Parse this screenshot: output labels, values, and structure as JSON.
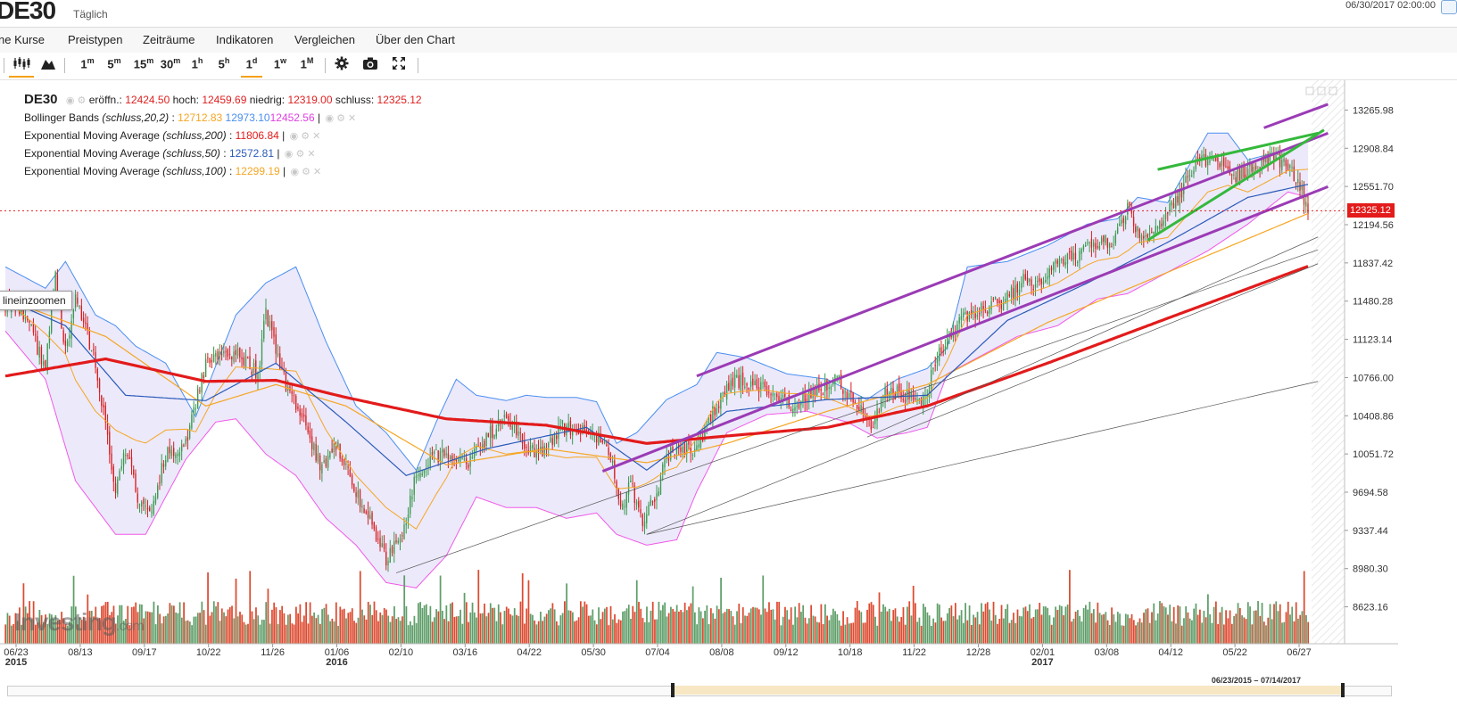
{
  "header": {
    "symbol": "DE30",
    "interval": "Täglich",
    "datetime": "06/30/2017 02:00:00"
  },
  "menu": [
    "ne Kurse",
    "Preistypen",
    "Zeiträume",
    "Indikatoren",
    "Vergleichen",
    "Über den Chart"
  ],
  "toolbar": {
    "timeframes": [
      "1m",
      "5m",
      "15m",
      "30m",
      "1h",
      "5h",
      "1d",
      "1w",
      "1M"
    ],
    "active": "1d"
  },
  "legend": {
    "symbol": "DE30",
    "open_label": "eröffn.:",
    "open": "12424.50",
    "high_label": "hoch:",
    "high": "12459.69",
    "low_label": "niedrig:",
    "low": "12319.00",
    "close_label": "schluss:",
    "close": "12325.12",
    "bb_label": "Bollinger Bands",
    "bb_params": "(schluss,20,2)",
    "bb_mid": "12712.83",
    "bb_upper": "12973.10",
    "bb_lower": "12452.56",
    "ema200_label": "Exponential Moving Average",
    "ema200_params": "(schluss,200)",
    "ema200_value": "11806.84",
    "ema50_label": "Exponential Moving Average",
    "ema50_params": "(schluss,50)",
    "ema50_value": "12572.81",
    "ema100_label": "Exponential Moving Average",
    "ema100_params": "(schluss,100)",
    "ema100_value": "12299.19"
  },
  "zoom_tooltip": "lineinzoomen",
  "last_price_label": "12325.12",
  "watermark": {
    "main": "Investing",
    "suffix": ".com"
  },
  "navigator": {
    "range": "06/23/2015 – 07/14/2017"
  },
  "colors": {
    "up": "#3a9a4e",
    "down": "#d61f1f",
    "bb_upper": "#4a8ff0",
    "bb_lower": "#f05ae8",
    "bb_mid": "#f5a623",
    "bb_fill": "#e4e0f9",
    "ema200": "#e21b1b",
    "ema50": "#2a5bb8",
    "ema100": "#f5a623",
    "channel": "#9b3bb5",
    "wedge": "#35b83c",
    "vol_up": "#5f9e69",
    "vol_down": "#dd4a30"
  },
  "chart_data": {
    "type": "candlestick",
    "y_ticks": [
      "13265.98",
      "12908.84",
      "12551.70",
      "12194.56",
      "11837.42",
      "11480.28",
      "11123.14",
      "10766.00",
      "10408.86",
      "10051.72",
      "9694.58",
      "9337.44",
      "8980.30",
      "8623.16"
    ],
    "y_range": [
      8444.59,
      13444.55
    ],
    "x_ticks": [
      {
        "label": "06/23",
        "sub": "2015"
      },
      {
        "label": "08/13",
        "sub": ""
      },
      {
        "label": "09/17",
        "sub": ""
      },
      {
        "label": "10/22",
        "sub": ""
      },
      {
        "label": "11/26",
        "sub": ""
      },
      {
        "label": "01/06",
        "sub": "2016"
      },
      {
        "label": "02/10",
        "sub": ""
      },
      {
        "label": "03/16",
        "sub": ""
      },
      {
        "label": "04/22",
        "sub": ""
      },
      {
        "label": "05/30",
        "sub": ""
      },
      {
        "label": "07/04",
        "sub": ""
      },
      {
        "label": "08/08",
        "sub": ""
      },
      {
        "label": "09/12",
        "sub": ""
      },
      {
        "label": "10/18",
        "sub": ""
      },
      {
        "label": "11/22",
        "sub": ""
      },
      {
        "label": "12/28",
        "sub": ""
      },
      {
        "label": "02/01",
        "sub": "2017"
      },
      {
        "label": "03/08",
        "sub": ""
      },
      {
        "label": "04/12",
        "sub": ""
      },
      {
        "label": "05/22",
        "sub": ""
      },
      {
        "label": "06/27",
        "sub": ""
      }
    ],
    "close_anchors": [
      [
        0,
        11480
      ],
      [
        10,
        11350
      ],
      [
        20,
        10850
      ],
      [
        25,
        11700
      ],
      [
        30,
        11000
      ],
      [
        35,
        11500
      ],
      [
        45,
        10900
      ],
      [
        55,
        9700
      ],
      [
        60,
        10100
      ],
      [
        66,
        9650
      ],
      [
        72,
        9450
      ],
      [
        80,
        10050
      ],
      [
        90,
        10150
      ],
      [
        100,
        10900
      ],
      [
        115,
        11000
      ],
      [
        126,
        10800
      ],
      [
        130,
        11380
      ],
      [
        140,
        10700
      ],
      [
        148,
        10400
      ],
      [
        158,
        9900
      ],
      [
        165,
        10150
      ],
      [
        175,
        9700
      ],
      [
        183,
        9400
      ],
      [
        190,
        9050
      ],
      [
        198,
        9300
      ],
      [
        205,
        9850
      ],
      [
        215,
        10050
      ],
      [
        230,
        9950
      ],
      [
        242,
        10250
      ],
      [
        250,
        10400
      ],
      [
        260,
        10100
      ],
      [
        268,
        10050
      ],
      [
        278,
        10300
      ],
      [
        290,
        10250
      ],
      [
        300,
        10150
      ],
      [
        308,
        9550
      ],
      [
        312,
        9780
      ],
      [
        318,
        9400
      ],
      [
        325,
        9700
      ],
      [
        330,
        10050
      ],
      [
        345,
        10100
      ],
      [
        352,
        10400
      ],
      [
        362,
        10750
      ],
      [
        372,
        10700
      ],
      [
        382,
        10650
      ],
      [
        392,
        10500
      ],
      [
        405,
        10650
      ],
      [
        415,
        10750
      ],
      [
        425,
        10500
      ],
      [
        432,
        10300
      ],
      [
        440,
        10650
      ],
      [
        450,
        10600
      ],
      [
        458,
        10550
      ],
      [
        465,
        10950
      ],
      [
        472,
        11200
      ],
      [
        480,
        11350
      ],
      [
        490,
        11420
      ],
      [
        500,
        11500
      ],
      [
        508,
        11680
      ],
      [
        515,
        11620
      ],
      [
        525,
        11850
      ],
      [
        535,
        11900
      ],
      [
        545,
        12050
      ],
      [
        553,
        12000
      ],
      [
        560,
        12380
      ],
      [
        566,
        12100
      ],
      [
        573,
        12120
      ],
      [
        580,
        12300
      ],
      [
        588,
        12550
      ],
      [
        595,
        12800
      ],
      [
        605,
        12800
      ],
      [
        612,
        12650
      ],
      [
        620,
        12700
      ],
      [
        632,
        12850
      ],
      [
        640,
        12750
      ],
      [
        646,
        12550
      ],
      [
        650,
        12325
      ]
    ],
    "ema200_anchors": [
      [
        0,
        10780
      ],
      [
        50,
        10940
      ],
      [
        100,
        10730
      ],
      [
        135,
        10740
      ],
      [
        170,
        10580
      ],
      [
        220,
        10380
      ],
      [
        270,
        10320
      ],
      [
        320,
        10150
      ],
      [
        360,
        10220
      ],
      [
        410,
        10300
      ],
      [
        460,
        10500
      ],
      [
        520,
        10900
      ],
      [
        580,
        11320
      ],
      [
        650,
        11806
      ]
    ],
    "ema100_anchors": [
      [
        0,
        11500
      ],
      [
        50,
        11150
      ],
      [
        100,
        10500
      ],
      [
        135,
        10700
      ],
      [
        170,
        10500
      ],
      [
        220,
        9950
      ],
      [
        270,
        10100
      ],
      [
        320,
        9970
      ],
      [
        360,
        10150
      ],
      [
        410,
        10450
      ],
      [
        460,
        10700
      ],
      [
        520,
        11280
      ],
      [
        580,
        11750
      ],
      [
        650,
        12299
      ]
    ],
    "ema50_anchors": [
      [
        0,
        11500
      ],
      [
        30,
        11250
      ],
      [
        60,
        10600
      ],
      [
        100,
        10550
      ],
      [
        135,
        10900
      ],
      [
        170,
        10350
      ],
      [
        200,
        9850
      ],
      [
        240,
        10100
      ],
      [
        290,
        10300
      ],
      [
        320,
        9900
      ],
      [
        360,
        10450
      ],
      [
        410,
        10560
      ],
      [
        460,
        10600
      ],
      [
        500,
        11300
      ],
      [
        540,
        11650
      ],
      [
        580,
        12030
      ],
      [
        620,
        12450
      ],
      [
        650,
        12572
      ]
    ],
    "bb_upper_anchors": [
      [
        0,
        11800
      ],
      [
        20,
        11600
      ],
      [
        30,
        11850
      ],
      [
        45,
        11350
      ],
      [
        55,
        11250
      ],
      [
        65,
        11060
      ],
      [
        80,
        10900
      ],
      [
        95,
        10400
      ],
      [
        115,
        11350
      ],
      [
        130,
        11650
      ],
      [
        145,
        11800
      ],
      [
        160,
        11100
      ],
      [
        175,
        10500
      ],
      [
        190,
        10250
      ],
      [
        205,
        9900
      ],
      [
        215,
        10350
      ],
      [
        225,
        10750
      ],
      [
        235,
        10600
      ],
      [
        250,
        10550
      ],
      [
        260,
        10600
      ],
      [
        270,
        10580
      ],
      [
        285,
        10580
      ],
      [
        295,
        10540
      ],
      [
        305,
        10150
      ],
      [
        315,
        10250
      ],
      [
        330,
        10560
      ],
      [
        345,
        10700
      ],
      [
        355,
        11000
      ],
      [
        370,
        10950
      ],
      [
        390,
        10800
      ],
      [
        410,
        10750
      ],
      [
        430,
        10560
      ],
      [
        445,
        10750
      ],
      [
        460,
        10850
      ],
      [
        470,
        11050
      ],
      [
        480,
        11800
      ],
      [
        500,
        11850
      ],
      [
        520,
        12000
      ],
      [
        540,
        12200
      ],
      [
        555,
        12250
      ],
      [
        565,
        12450
      ],
      [
        580,
        12400
      ],
      [
        600,
        13050
      ],
      [
        610,
        13050
      ],
      [
        620,
        12800
      ],
      [
        640,
        12900
      ],
      [
        650,
        12973
      ]
    ],
    "bb_lower_anchors": [
      [
        0,
        11200
      ],
      [
        20,
        10750
      ],
      [
        35,
        9800
      ],
      [
        55,
        9300
      ],
      [
        70,
        9300
      ],
      [
        90,
        10000
      ],
      [
        105,
        10350
      ],
      [
        115,
        10380
      ],
      [
        130,
        10050
      ],
      [
        145,
        9850
      ],
      [
        160,
        9450
      ],
      [
        175,
        9200
      ],
      [
        190,
        8850
      ],
      [
        205,
        8800
      ],
      [
        220,
        9100
      ],
      [
        235,
        9650
      ],
      [
        250,
        9550
      ],
      [
        265,
        9550
      ],
      [
        280,
        9450
      ],
      [
        295,
        9500
      ],
      [
        305,
        9300
      ],
      [
        320,
        9200
      ],
      [
        335,
        9250
      ],
      [
        345,
        9700
      ],
      [
        360,
        10250
      ],
      [
        380,
        10420
      ],
      [
        400,
        10450
      ],
      [
        420,
        10350
      ],
      [
        435,
        10200
      ],
      [
        450,
        10250
      ],
      [
        460,
        10300
      ],
      [
        470,
        10800
      ],
      [
        490,
        11000
      ],
      [
        505,
        11150
      ],
      [
        525,
        11250
      ],
      [
        545,
        11500
      ],
      [
        560,
        11550
      ],
      [
        575,
        11700
      ],
      [
        590,
        11850
      ],
      [
        600,
        11950
      ],
      [
        620,
        12200
      ],
      [
        640,
        12500
      ],
      [
        650,
        12452
      ]
    ],
    "trendlines": [
      {
        "kind": "channel",
        "from": [
          345,
          10780
        ],
        "to": [
          660,
          13050
        ]
      },
      {
        "kind": "channel",
        "from": [
          298,
          9890
        ],
        "to": [
          660,
          12550
        ]
      },
      {
        "kind": "channel",
        "from": [
          628,
          13100
        ],
        "to": [
          660,
          13320
        ]
      },
      {
        "kind": "wedge",
        "from": [
          575,
          12710
        ],
        "to": [
          655,
          13050
        ]
      },
      {
        "kind": "wedge",
        "from": [
          570,
          12050
        ],
        "to": [
          658,
          13080
        ]
      },
      {
        "kind": "thin",
        "from": [
          195,
          8940
        ],
        "to": [
          655,
          11960
        ]
      },
      {
        "kind": "thin",
        "from": [
          320,
          9300
        ],
        "to": [
          655,
          11830
        ]
      },
      {
        "kind": "thin",
        "from": [
          430,
          10210
        ],
        "to": [
          655,
          12080
        ]
      },
      {
        "kind": "thin",
        "from": [
          320,
          9300
        ],
        "to": [
          655,
          10730
        ]
      }
    ]
  }
}
